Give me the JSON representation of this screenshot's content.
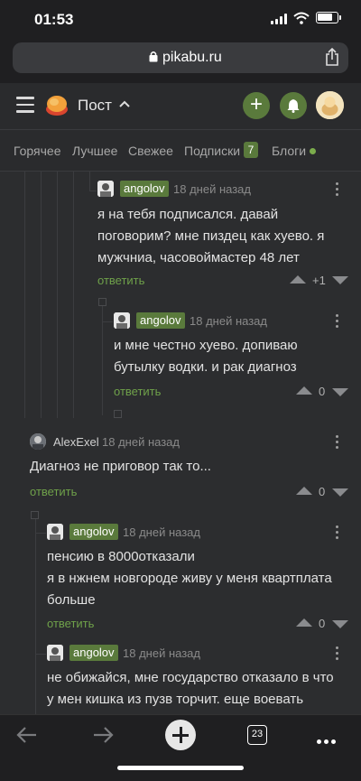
{
  "status": {
    "time": "01:53"
  },
  "browser": {
    "url": "pikabu.ru",
    "tabs_count": "23"
  },
  "header": {
    "title": "Пост"
  },
  "tabs": [
    {
      "label": "Горячее"
    },
    {
      "label": "Лучшее"
    },
    {
      "label": "Свежее"
    },
    {
      "label": "Подписки"
    },
    {
      "label": "Блоги"
    }
  ],
  "subscriptions_badge": "7",
  "comments": [
    {
      "author": "angolov",
      "date": "18 дней назад",
      "lines": [
        "я на тебя подписался. давай",
        "поговорим? мне пиздец как хуево. я",
        "мужчниа, часовоймастер 48 лет"
      ],
      "reply": "ответить",
      "score": "+1"
    },
    {
      "author": "angolov",
      "date": "18 дней назад",
      "lines": [
        "и мне честно хуево. допиваю",
        "бутылку водки. и рак диагноз"
      ],
      "reply": "ответить",
      "score": "0"
    },
    {
      "author": "AlexExel",
      "date": "18 дней назад",
      "lines": [
        "Диагноз не приговор так то..."
      ],
      "reply": "ответить",
      "score": "0"
    },
    {
      "author": "angolov",
      "date": "18 дней назад",
      "lines": [
        "пенсию в 8000отказали",
        "я в нжнем новгороде живу у меня квартплата",
        "больше"
      ],
      "reply": "ответить",
      "score": "0"
    },
    {
      "author": "angolov",
      "date": "18 дней назад",
      "lines": [
        "не обижайся, мне государство отказало в  что",
        "у мен кишка из пузв торчит. еще воевать"
      ],
      "reply": "",
      "score": ""
    }
  ],
  "colors": {
    "accent": "#5a7a3c",
    "reply_link": "#6fa14a",
    "background": "#2c2d2f"
  }
}
